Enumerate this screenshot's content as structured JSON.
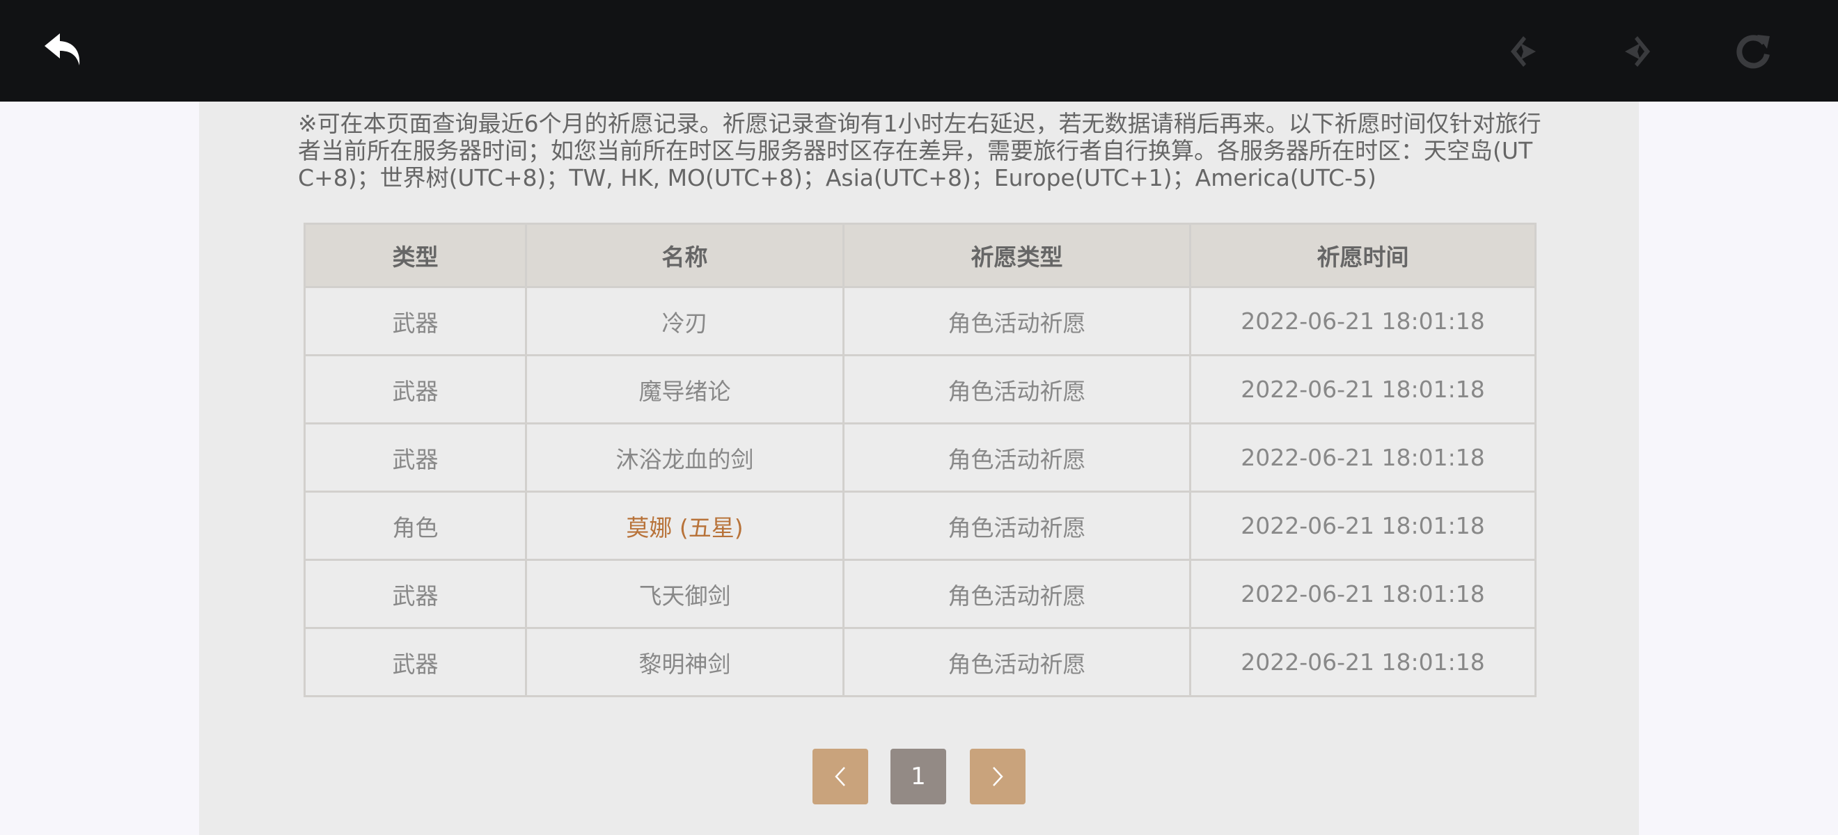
{
  "notice": "※可在本页面查询最近6个月的祈愿记录。祈愿记录查询有1小时左右延迟，若无数据请稍后再来。以下祈愿时间仅针对旅行者当前所在服务器时间；如您当前所在时区与服务器时区存在差异，需要旅行者自行换算。各服务器所在时区：天空岛(UTC+8)；世界树(UTC+8)；TW, HK, MO(UTC+8)；Asia(UTC+8)；Europe(UTC+1)；America(UTC-5)",
  "table": {
    "headers": [
      "类型",
      "名称",
      "祈愿类型",
      "祈愿时间"
    ],
    "rows": [
      {
        "type": "武器",
        "name": "冷刃",
        "wish_type": "角色活动祈愿",
        "time": "2022-06-21 18:01:18"
      },
      {
        "type": "武器",
        "name": "魔导绪论",
        "wish_type": "角色活动祈愿",
        "time": "2022-06-21 18:01:18"
      },
      {
        "type": "武器",
        "name": "沐浴龙血的剑",
        "wish_type": "角色活动祈愿",
        "time": "2022-06-21 18:01:18"
      },
      {
        "type": "角色",
        "name": "莫娜 (五星)",
        "wish_type": "角色活动祈愿",
        "time": "2022-06-21 18:01:18"
      },
      {
        "type": "武器",
        "name": "飞天御剑",
        "wish_type": "角色活动祈愿",
        "time": "2022-06-21 18:01:18"
      },
      {
        "type": "武器",
        "name": "黎明神剑",
        "wish_type": "角色活动祈愿",
        "time": "2022-06-21 18:01:18"
      }
    ]
  },
  "pagination": {
    "prev_icon": "chevron-left-icon",
    "current_page": "1",
    "next_icon": "chevron-right-icon"
  },
  "toolbar": {
    "back_icon": "back-arrow-icon",
    "prev_icon": "prev-icon",
    "next_icon": "next-icon",
    "reload_icon": "reload-icon"
  },
  "colors": {
    "topbar": "#111214",
    "panel": "#ebebeb",
    "header_row": "#dcd9d4",
    "five_star_text": "#b8733a",
    "pager_button": "#c9a37c",
    "pager_current": "#938a85"
  }
}
